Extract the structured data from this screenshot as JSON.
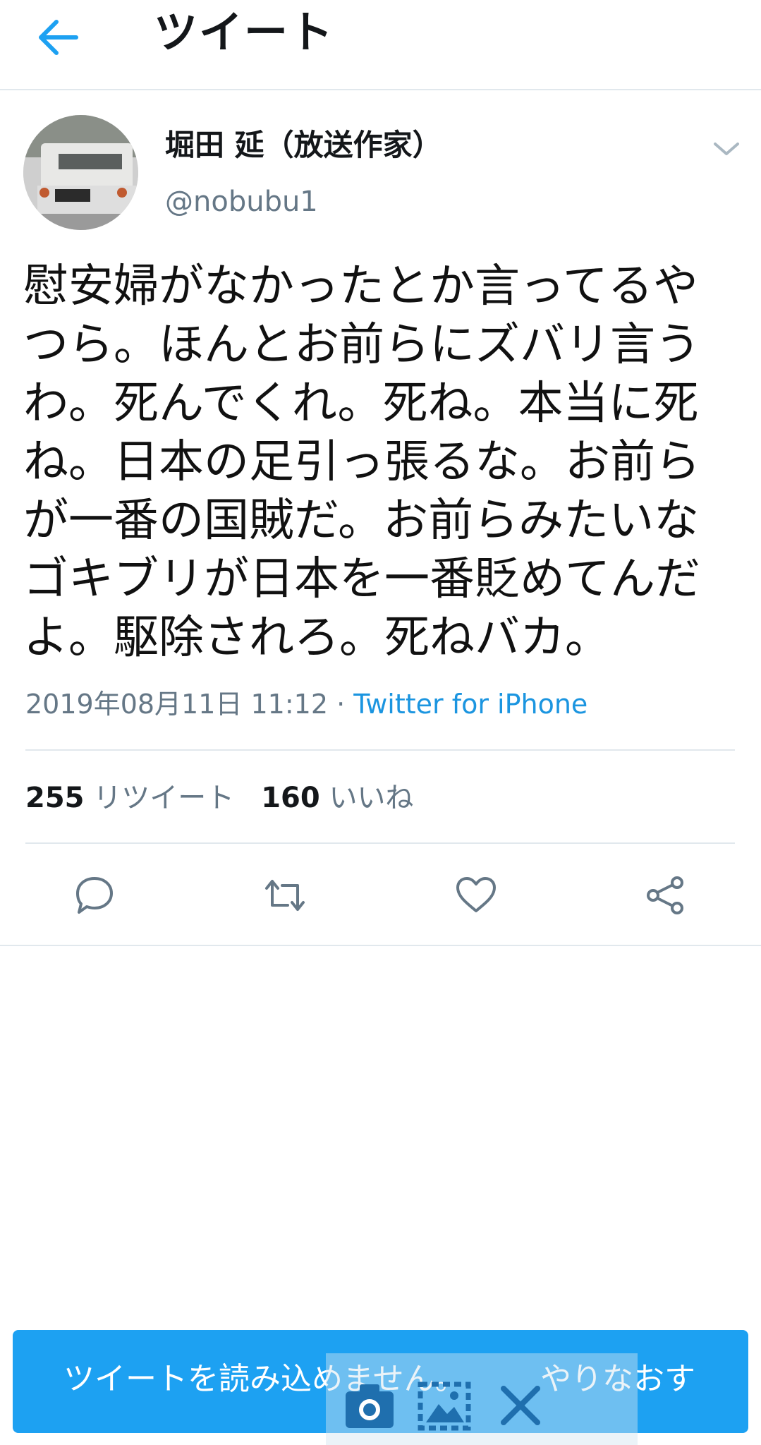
{
  "header": {
    "title": "ツイート"
  },
  "author": {
    "name": "堀田 延（放送作家）",
    "handle": "@nobubu1"
  },
  "tweet": {
    "lines": [
      "慰安婦がなかったとか言ってるや",
      "つら。ほんとお前らにズバリ言う",
      "わ。死んでくれ。死ね。本当に死",
      "ね。日本の足引っ張るな。お前ら",
      "が一番の国賊だ。お前らみたいな",
      "ゴキブリが日本を一番貶めてんだ",
      "よ。駆除されろ。死ねバカ。"
    ],
    "timestamp": "2019年08月11日 11:12",
    "separator": " · ",
    "client": "Twitter for iPhone"
  },
  "stats": {
    "retweets_count": "255",
    "retweets_label": "リツイート",
    "likes_count": "160",
    "likes_label": "いいね"
  },
  "actions": [
    "reply-icon",
    "retweet-icon",
    "like-icon",
    "share-icon"
  ],
  "snackbar": {
    "message": "ツイートを読み込めません。",
    "retry_label": "やりなおす"
  },
  "colors": {
    "accent": "#1da1f2",
    "link": "#1b95e0",
    "secondary_text": "#657786",
    "divider": "#e1e8ed"
  }
}
